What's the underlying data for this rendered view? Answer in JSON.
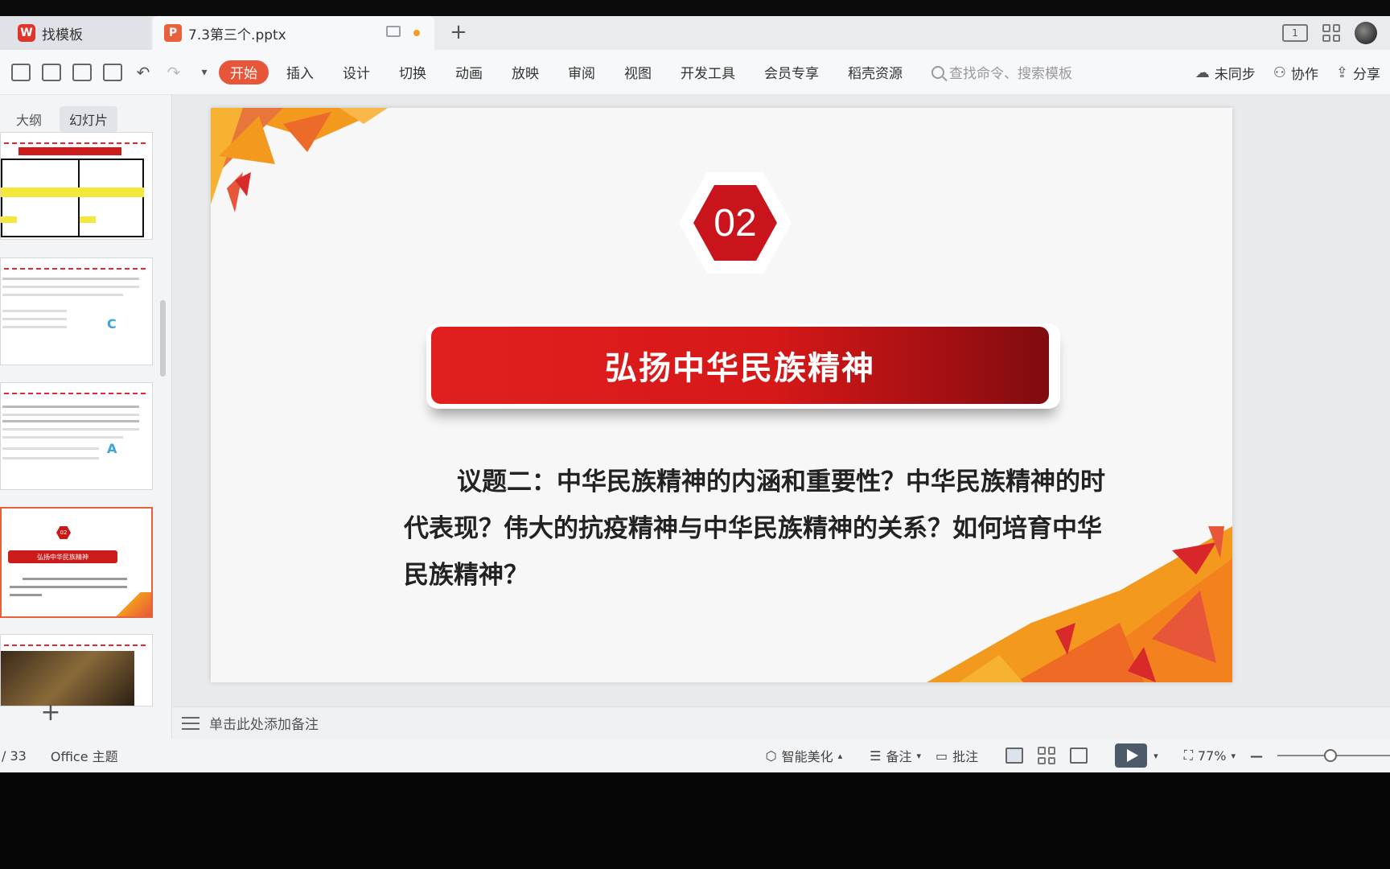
{
  "tabs": {
    "template_tab": "找模板",
    "doc_tab": "7.3第三个.pptx",
    "new_tab": "+"
  },
  "tabbar_right": {
    "layout_icon_text": "1"
  },
  "ribbon": {
    "menu": [
      "开始",
      "插入",
      "设计",
      "切换",
      "动画",
      "放映",
      "审阅",
      "视图",
      "开发工具",
      "会员专享",
      "稻壳资源"
    ],
    "search_placeholder": "查找命令、搜索模板",
    "sync": "未同步",
    "collab": "协作",
    "share": "分享"
  },
  "sidebar": {
    "tab_outline": "大纲",
    "tab_slides": "幻灯片",
    "add": "+",
    "thumb2_letter": "C",
    "thumb3_letter": "A",
    "thumb4_hex": "02",
    "thumb4_title": "弘扬中华民族精神"
  },
  "slide": {
    "number": "02",
    "title": "弘扬中华民族精神",
    "body": "议题二：中华民族精神的内涵和重要性？中华民族精神的时代表现？伟大的抗疫精神与中华民族精神的关系？如何培育中华民族精神？"
  },
  "notes": {
    "placeholder": "单击此处添加备注"
  },
  "status": {
    "page": "/ 33",
    "theme": "Office 主题",
    "beautify": "智能美化",
    "notes": "备注",
    "comment": "批注",
    "zoom": "77%",
    "zoom_minus": "—"
  },
  "colors": {
    "accent": "#e8563a",
    "title_red": "#d61818",
    "deco_orange": "#f39a1e"
  }
}
